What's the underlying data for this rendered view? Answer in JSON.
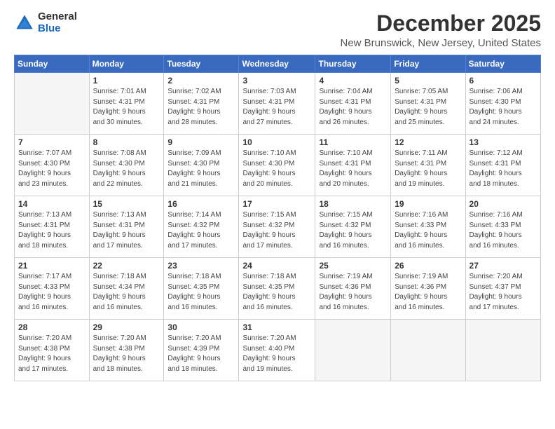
{
  "logo": {
    "general": "General",
    "blue": "Blue"
  },
  "title": "December 2025",
  "subtitle": "New Brunswick, New Jersey, United States",
  "days_header": [
    "Sunday",
    "Monday",
    "Tuesday",
    "Wednesday",
    "Thursday",
    "Friday",
    "Saturday"
  ],
  "weeks": [
    [
      {
        "day": "",
        "info": ""
      },
      {
        "day": "1",
        "info": "Sunrise: 7:01 AM\nSunset: 4:31 PM\nDaylight: 9 hours\nand 30 minutes."
      },
      {
        "day": "2",
        "info": "Sunrise: 7:02 AM\nSunset: 4:31 PM\nDaylight: 9 hours\nand 28 minutes."
      },
      {
        "day": "3",
        "info": "Sunrise: 7:03 AM\nSunset: 4:31 PM\nDaylight: 9 hours\nand 27 minutes."
      },
      {
        "day": "4",
        "info": "Sunrise: 7:04 AM\nSunset: 4:31 PM\nDaylight: 9 hours\nand 26 minutes."
      },
      {
        "day": "5",
        "info": "Sunrise: 7:05 AM\nSunset: 4:31 PM\nDaylight: 9 hours\nand 25 minutes."
      },
      {
        "day": "6",
        "info": "Sunrise: 7:06 AM\nSunset: 4:30 PM\nDaylight: 9 hours\nand 24 minutes."
      }
    ],
    [
      {
        "day": "7",
        "info": "Sunrise: 7:07 AM\nSunset: 4:30 PM\nDaylight: 9 hours\nand 23 minutes."
      },
      {
        "day": "8",
        "info": "Sunrise: 7:08 AM\nSunset: 4:30 PM\nDaylight: 9 hours\nand 22 minutes."
      },
      {
        "day": "9",
        "info": "Sunrise: 7:09 AM\nSunset: 4:30 PM\nDaylight: 9 hours\nand 21 minutes."
      },
      {
        "day": "10",
        "info": "Sunrise: 7:10 AM\nSunset: 4:30 PM\nDaylight: 9 hours\nand 20 minutes."
      },
      {
        "day": "11",
        "info": "Sunrise: 7:10 AM\nSunset: 4:31 PM\nDaylight: 9 hours\nand 20 minutes."
      },
      {
        "day": "12",
        "info": "Sunrise: 7:11 AM\nSunset: 4:31 PM\nDaylight: 9 hours\nand 19 minutes."
      },
      {
        "day": "13",
        "info": "Sunrise: 7:12 AM\nSunset: 4:31 PM\nDaylight: 9 hours\nand 18 minutes."
      }
    ],
    [
      {
        "day": "14",
        "info": "Sunrise: 7:13 AM\nSunset: 4:31 PM\nDaylight: 9 hours\nand 18 minutes."
      },
      {
        "day": "15",
        "info": "Sunrise: 7:13 AM\nSunset: 4:31 PM\nDaylight: 9 hours\nand 17 minutes."
      },
      {
        "day": "16",
        "info": "Sunrise: 7:14 AM\nSunset: 4:32 PM\nDaylight: 9 hours\nand 17 minutes."
      },
      {
        "day": "17",
        "info": "Sunrise: 7:15 AM\nSunset: 4:32 PM\nDaylight: 9 hours\nand 17 minutes."
      },
      {
        "day": "18",
        "info": "Sunrise: 7:15 AM\nSunset: 4:32 PM\nDaylight: 9 hours\nand 16 minutes."
      },
      {
        "day": "19",
        "info": "Sunrise: 7:16 AM\nSunset: 4:33 PM\nDaylight: 9 hours\nand 16 minutes."
      },
      {
        "day": "20",
        "info": "Sunrise: 7:16 AM\nSunset: 4:33 PM\nDaylight: 9 hours\nand 16 minutes."
      }
    ],
    [
      {
        "day": "21",
        "info": "Sunrise: 7:17 AM\nSunset: 4:33 PM\nDaylight: 9 hours\nand 16 minutes."
      },
      {
        "day": "22",
        "info": "Sunrise: 7:18 AM\nSunset: 4:34 PM\nDaylight: 9 hours\nand 16 minutes."
      },
      {
        "day": "23",
        "info": "Sunrise: 7:18 AM\nSunset: 4:35 PM\nDaylight: 9 hours\nand 16 minutes."
      },
      {
        "day": "24",
        "info": "Sunrise: 7:18 AM\nSunset: 4:35 PM\nDaylight: 9 hours\nand 16 minutes."
      },
      {
        "day": "25",
        "info": "Sunrise: 7:19 AM\nSunset: 4:36 PM\nDaylight: 9 hours\nand 16 minutes."
      },
      {
        "day": "26",
        "info": "Sunrise: 7:19 AM\nSunset: 4:36 PM\nDaylight: 9 hours\nand 16 minutes."
      },
      {
        "day": "27",
        "info": "Sunrise: 7:20 AM\nSunset: 4:37 PM\nDaylight: 9 hours\nand 17 minutes."
      }
    ],
    [
      {
        "day": "28",
        "info": "Sunrise: 7:20 AM\nSunset: 4:38 PM\nDaylight: 9 hours\nand 17 minutes."
      },
      {
        "day": "29",
        "info": "Sunrise: 7:20 AM\nSunset: 4:38 PM\nDaylight: 9 hours\nand 18 minutes."
      },
      {
        "day": "30",
        "info": "Sunrise: 7:20 AM\nSunset: 4:39 PM\nDaylight: 9 hours\nand 18 minutes."
      },
      {
        "day": "31",
        "info": "Sunrise: 7:20 AM\nSunset: 4:40 PM\nDaylight: 9 hours\nand 19 minutes."
      },
      {
        "day": "",
        "info": ""
      },
      {
        "day": "",
        "info": ""
      },
      {
        "day": "",
        "info": ""
      }
    ]
  ]
}
